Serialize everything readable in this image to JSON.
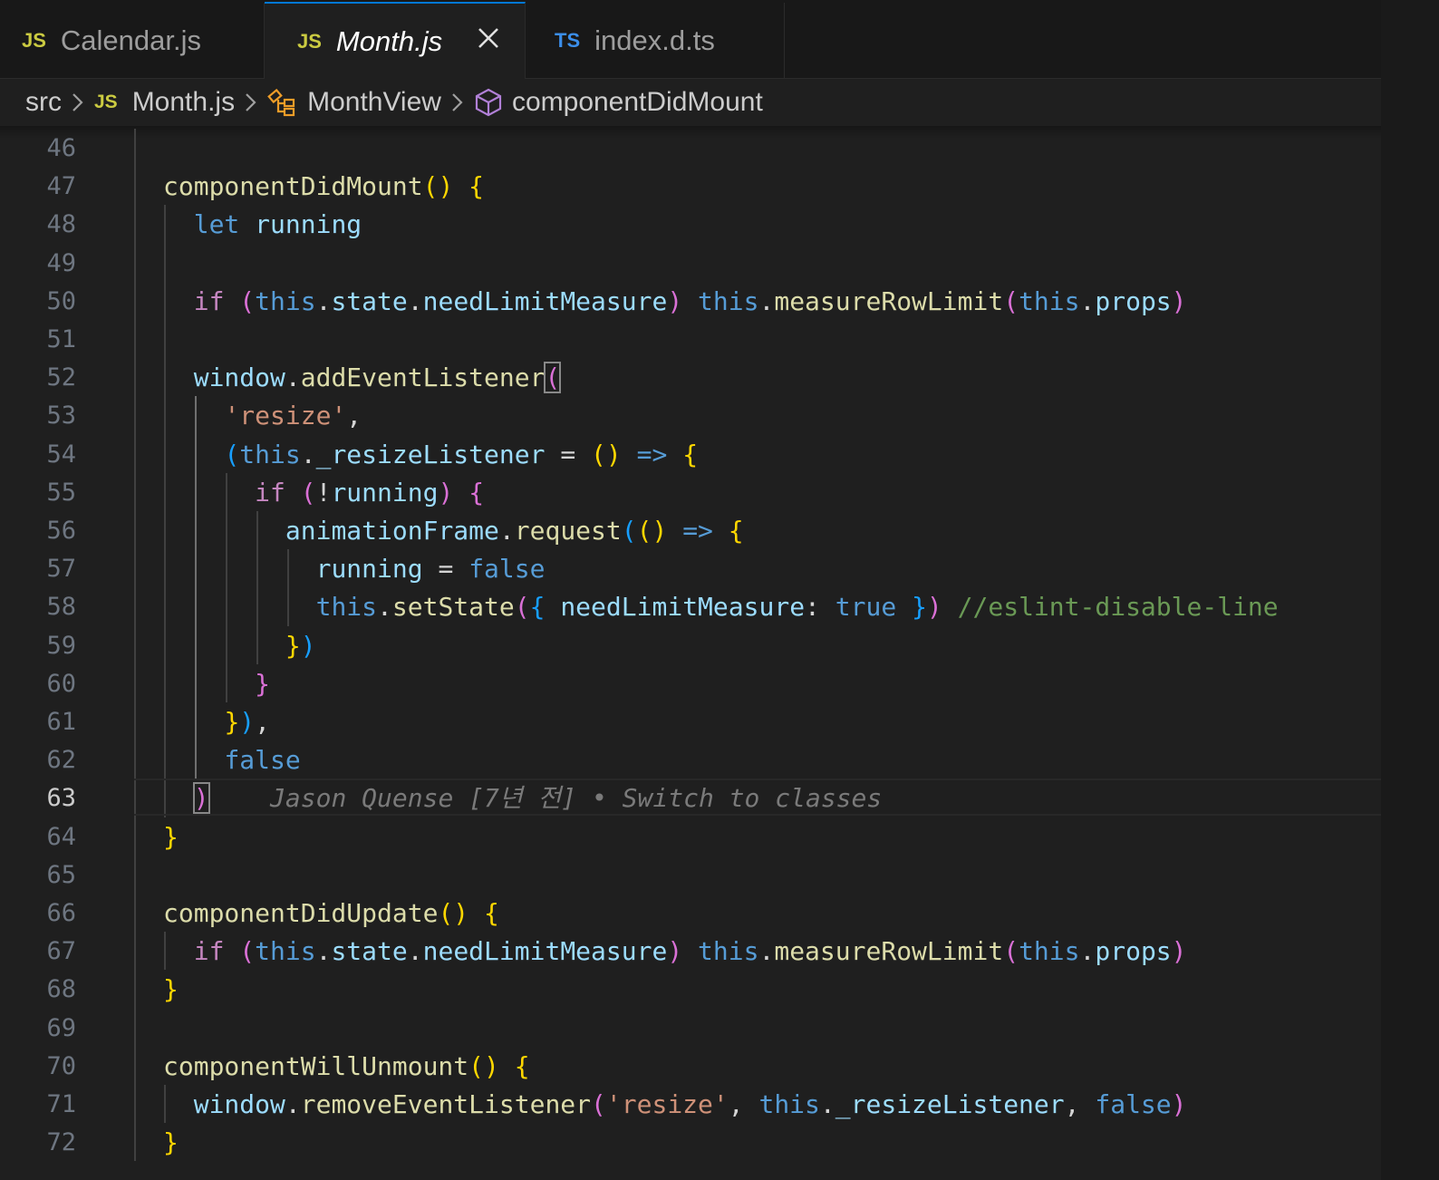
{
  "tabs": [
    {
      "lang": "JS",
      "label": "Calendar.js",
      "active": false
    },
    {
      "lang": "JS",
      "label": "Month.js",
      "active": true
    },
    {
      "lang": "TS",
      "label": "index.d.ts",
      "active": false
    }
  ],
  "breadcrumb": {
    "folder": "src",
    "file_lang": "JS",
    "file": "Month.js",
    "class": "MonthView",
    "method": "componentDidMount"
  },
  "editor": {
    "current_line": 63,
    "blame": "Jason Quense [7년 전] • Switch to classes",
    "lines": [
      {
        "n": "46",
        "text": ""
      },
      {
        "n": "47",
        "text": "componentDidMount() {"
      },
      {
        "n": "48",
        "text": "  let running"
      },
      {
        "n": "49",
        "text": ""
      },
      {
        "n": "50",
        "text": "  if (this.state.needLimitMeasure) this.measureRowLimit(this.props)"
      },
      {
        "n": "51",
        "text": ""
      },
      {
        "n": "52",
        "text": "  window.addEventListener("
      },
      {
        "n": "53",
        "text": "    'resize',"
      },
      {
        "n": "54",
        "text": "    (this._resizeListener = () => {"
      },
      {
        "n": "55",
        "text": "      if (!running) {"
      },
      {
        "n": "56",
        "text": "        animationFrame.request(() => {"
      },
      {
        "n": "57",
        "text": "          running = false"
      },
      {
        "n": "58",
        "text": "          this.setState({ needLimitMeasure: true }) //eslint-disable-line"
      },
      {
        "n": "59",
        "text": "        })"
      },
      {
        "n": "60",
        "text": "      }"
      },
      {
        "n": "61",
        "text": "    }),"
      },
      {
        "n": "62",
        "text": "    false"
      },
      {
        "n": "63",
        "text": "  )"
      },
      {
        "n": "64",
        "text": "}"
      },
      {
        "n": "65",
        "text": ""
      },
      {
        "n": "66",
        "text": "componentDidUpdate() {"
      },
      {
        "n": "67",
        "text": "  if (this.state.needLimitMeasure) this.measureRowLimit(this.props)"
      },
      {
        "n": "68",
        "text": "}"
      },
      {
        "n": "69",
        "text": ""
      },
      {
        "n": "70",
        "text": "componentWillUnmount() {"
      },
      {
        "n": "71",
        "text": "  window.removeEventListener('resize', this._resizeListener, false)"
      },
      {
        "n": "72",
        "text": "}"
      }
    ]
  },
  "colors": {
    "background": "#1f1f1f",
    "active_tab_border": "#0078d4",
    "keyword": "#569cd6",
    "control": "#c586c0",
    "function": "#dcdcaa",
    "variable": "#9cdcfe",
    "string": "#ce9178",
    "comment": "#6a9955"
  },
  "icons": [
    "close-icon",
    "chevron-right-icon",
    "symbol-class-icon",
    "symbol-method-icon"
  ]
}
